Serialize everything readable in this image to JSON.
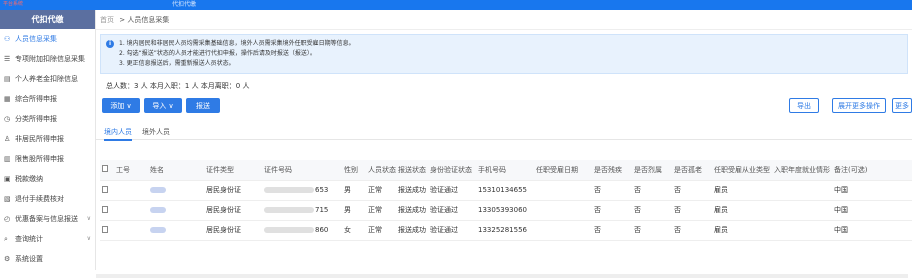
{
  "topbar": {
    "logo": "平台系统",
    "title": "代扣代缴"
  },
  "sidebar": {
    "header": "代扣代缴",
    "items": [
      {
        "label": "人员信息采集",
        "icon": "person-icon",
        "active": true
      },
      {
        "label": "专项附加扣除信息采集",
        "icon": "list-icon"
      },
      {
        "label": "个人养老金扣除信息",
        "icon": "doc-icon"
      },
      {
        "label": "综合所得申报",
        "icon": "form-icon"
      },
      {
        "label": "分类所得申报",
        "icon": "clock-icon"
      },
      {
        "label": "非居民所得申报",
        "icon": "user-icon"
      },
      {
        "label": "限售股所得申报",
        "icon": "file-icon"
      },
      {
        "label": "税款缴纳",
        "icon": "pay-icon"
      },
      {
        "label": "退付手续费核对",
        "icon": "list2-icon"
      },
      {
        "label": "优惠备案与信息报送",
        "icon": "clock2-icon",
        "chevron": true
      },
      {
        "label": "查询统计",
        "icon": "search-icon",
        "chevron": true
      },
      {
        "label": "系统设置",
        "icon": "gear-icon"
      }
    ]
  },
  "breadcrumb": {
    "home": "首页",
    "sep": ">",
    "current": "人员信息采集"
  },
  "notice": {
    "lines": [
      "1. 境内居民和非居民人员均需采集基础信息，境外人员需采集境外任职受雇日期等信息。",
      "2. 勾选“报送”状态的人员才能进行代扣申报，操作后请及时报送（报送）。",
      "3. 更正信息报送后，需重新报送人员状态。"
    ]
  },
  "stats": "总人数：3 人  本月入职：1 人  本月离职：0 人",
  "toolbar": {
    "add": "添加 ∨",
    "import": "导入 ∨",
    "report": "报送",
    "export": "导出",
    "more_ops": "展开更多操作",
    "more": "更多"
  },
  "tabs": [
    "境内人员",
    "境外人员"
  ],
  "table": {
    "headers": [
      "",
      "工号",
      "姓名",
      "证件类型",
      "证件号码",
      "性别",
      "人员状态",
      "报送状态",
      "身份验证状态",
      "手机号码",
      "任职受雇日期",
      "是否残疾",
      "是否烈属",
      "是否孤老",
      "任职受雇从业类型",
      "入职年度就业情形",
      "备注(可选)"
    ],
    "rows": [
      {
        "id_tail": "653",
        "gender": "男",
        "state": "正常",
        "report": "报送成功",
        "verify": "验证通过",
        "phone": "15310134655",
        "disabled": "否",
        "martyr": "否",
        "alone": "否",
        "type": "雇员",
        "note": "中国",
        "id_type": "居民身份证"
      },
      {
        "id_tail": "715",
        "gender": "男",
        "state": "正常",
        "report": "报送成功",
        "verify": "验证通过",
        "phone": "13305393060",
        "disabled": "否",
        "martyr": "否",
        "alone": "否",
        "type": "雇员",
        "note": "中国",
        "id_type": "居民身份证"
      },
      {
        "id_tail": "860",
        "gender": "女",
        "state": "正常",
        "report": "报送成功",
        "verify": "验证通过",
        "phone": "13325281556",
        "disabled": "否",
        "martyr": "否",
        "alone": "否",
        "type": "雇员",
        "note": "中国",
        "id_type": "居民身份证"
      }
    ]
  }
}
